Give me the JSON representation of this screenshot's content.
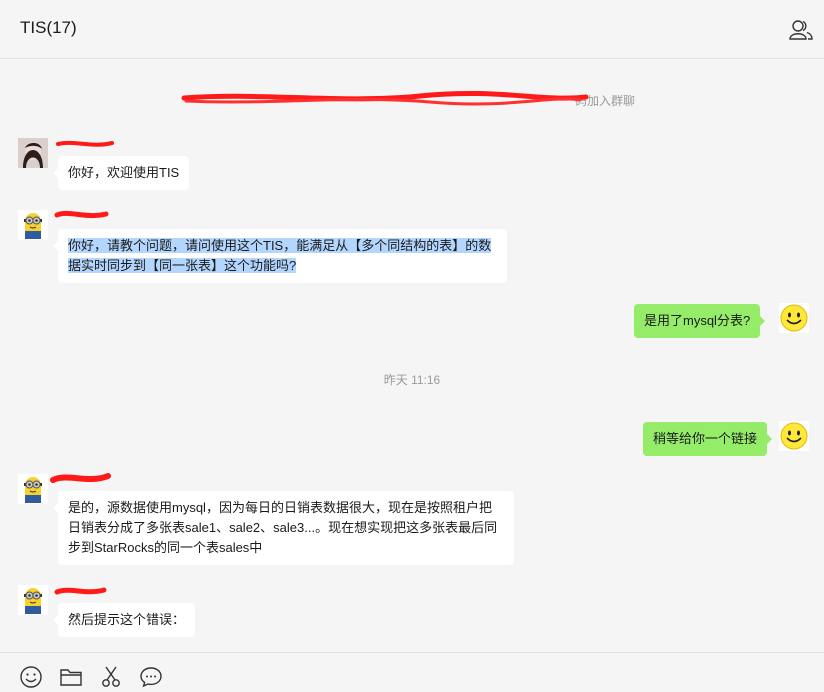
{
  "window": {
    "title": "TIS(17)"
  },
  "header_icons": {
    "members": "members-icon"
  },
  "system_notice": {
    "visible_suffix": "码加入群聊"
  },
  "messages": [
    {
      "side": "left",
      "avatar": "girl-photo",
      "text": "你好，欢迎使用TIS"
    },
    {
      "side": "left",
      "avatar": "minion",
      "text_line1": "你好，请教个问题，请问使用这个TIS，能满足从【多个同结构的表】的数",
      "text_line2": "据实时同步到【同一张表】这个功能吗?"
    },
    {
      "side": "right",
      "avatar": "smiley",
      "text": "是用了mysql分表?"
    },
    {
      "side": "right",
      "avatar": "smiley",
      "text": "稍等给你一个链接"
    },
    {
      "side": "left",
      "avatar": "minion",
      "text_line1": "是的，源数据使用mysql，因为每日的日销表数据很大，现在是按照租户把",
      "text_line2": "日销表分成了多张表sale1、sale2、sale3...。现在想实现把这多张表最后同",
      "text_line3": "步到StarRocks的同一个表sales中"
    },
    {
      "side": "left",
      "avatar": "minion",
      "text": "然后提示这个错误："
    }
  ],
  "timestamp": "昨天 11:16",
  "toolbar": [
    "emoji-icon",
    "folder-icon",
    "scissors-icon",
    "chat-bubble-icon"
  ],
  "colors": {
    "self_bubble": "#95ec69",
    "other_bubble": "#ffffff",
    "redaction": "#ff1a1a",
    "highlight": "#b3d6ff"
  }
}
